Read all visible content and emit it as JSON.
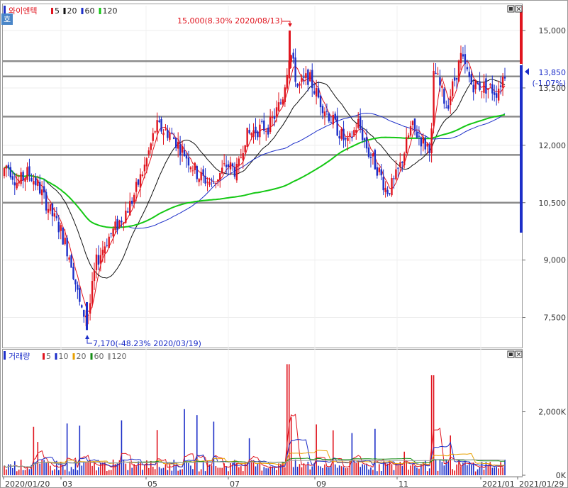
{
  "chart_data": [
    {
      "type": "candlestick",
      "title": "와이엔텍",
      "ma_legend": [
        {
          "label": "5",
          "color": "#e0141e"
        },
        {
          "label": "20",
          "color": "#111111"
        },
        {
          "label": "60",
          "color": "#1c2ec8"
        },
        {
          "label": "120",
          "color": "#14c814"
        }
      ],
      "y_ticks": [
        "15,000",
        "13,500",
        "12,000",
        "10,500",
        "9,000",
        "7,500"
      ],
      "y_tick_values": [
        15000,
        13500,
        12000,
        10500,
        9000,
        7500
      ],
      "ylim": [
        6750,
        15650
      ],
      "support_lines": [
        14200,
        13800,
        12750,
        11750,
        10500
      ],
      "current_price": "13,850",
      "current_change": "(-1.07%)",
      "current_value": 13850,
      "high_annotation": "15,000(8.30% 2020/08/13)",
      "low_annotation": "7,170(-48.23% 2020/03/19)",
      "high": 15000,
      "low": 7170,
      "ma_end_values": {
        "ma5": 13700,
        "ma20": 13450,
        "ma60": 12650,
        "ma120": 12750
      }
    },
    {
      "type": "bar",
      "title": "거래량",
      "legend": [
        {
          "label": "5",
          "color": "#e0141e"
        },
        {
          "label": "10",
          "color": "#1c2ec8"
        },
        {
          "label": "20",
          "color": "#e8a000"
        },
        {
          "label": "60",
          "color": "#148c14"
        },
        {
          "label": "120",
          "color": "#a0a0a0"
        }
      ],
      "y_ticks": [
        "2,000K",
        "0K"
      ],
      "y_tick_values": [
        2000,
        0
      ],
      "ylim": [
        0,
        3800
      ],
      "unit": "K"
    }
  ],
  "x_axis": {
    "labels": [
      "2020/01/20",
      "03",
      "05",
      "07",
      "09",
      "11",
      "2021/01",
      "2021/01/29"
    ]
  },
  "ui": {
    "corner_badge": "호",
    "window_buttons": [
      "▣",
      "×"
    ]
  }
}
